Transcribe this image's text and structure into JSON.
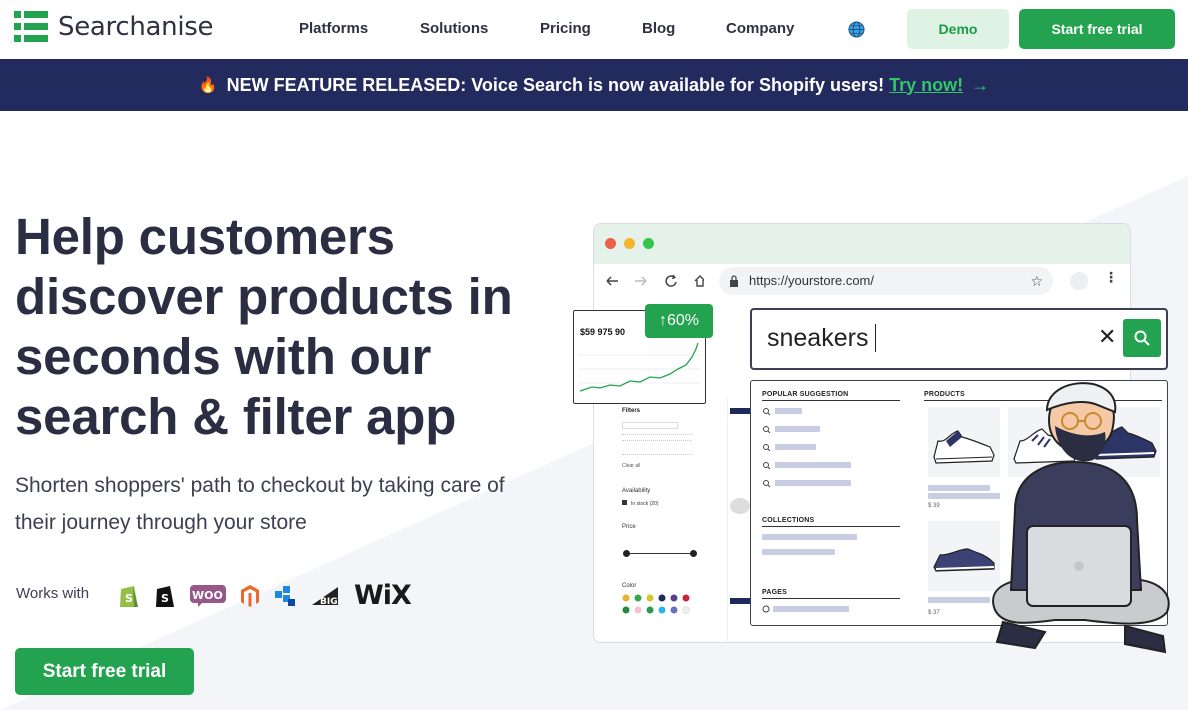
{
  "header": {
    "brand": "Searchanise",
    "nav": [
      "Platforms",
      "Solutions",
      "Pricing",
      "Blog",
      "Company"
    ],
    "demo_label": "Demo",
    "trial_label": "Start free trial"
  },
  "banner": {
    "text": "NEW FEATURE RELEASED: Voice Search is now available for Shopify users!",
    "link": "Try now!"
  },
  "hero": {
    "headline": "Help customers discover products in seconds with our search & filter app",
    "subtitle": "Shorten shoppers' path to checkout by taking care of their journey through your store",
    "works_with": "Works with",
    "cta": "Start free trial"
  },
  "platforms": [
    "shopify-icon",
    "shopify-plus-icon",
    "woocommerce-icon",
    "magento-icon",
    "squarespace-icon",
    "bigcommerce-icon",
    "wix-icon"
  ],
  "platform_text": {
    "woo": "WOO",
    "big": "BIG",
    "wix": "WiX"
  },
  "mockup": {
    "url": "https://yourstore.com/",
    "chart_value": "$59 975 90",
    "growth": "↑60%",
    "query": "sneakers",
    "sections": {
      "popular": "POPULAR SUGGESTION",
      "collections": "COLLECTIONS",
      "pages": "PAGES",
      "products": "PRODUCTS"
    },
    "filters": {
      "title": "Filters",
      "availability": "Availability",
      "in_stock": "In stock (20)",
      "price": "Price",
      "color": "Color",
      "clear": "Clear all"
    },
    "prices": [
      "$ 39",
      "$ 37"
    ]
  },
  "colors": {
    "accent": "#23a350",
    "banner_bg": "#232a5e",
    "text_dark": "#2b2d42"
  }
}
